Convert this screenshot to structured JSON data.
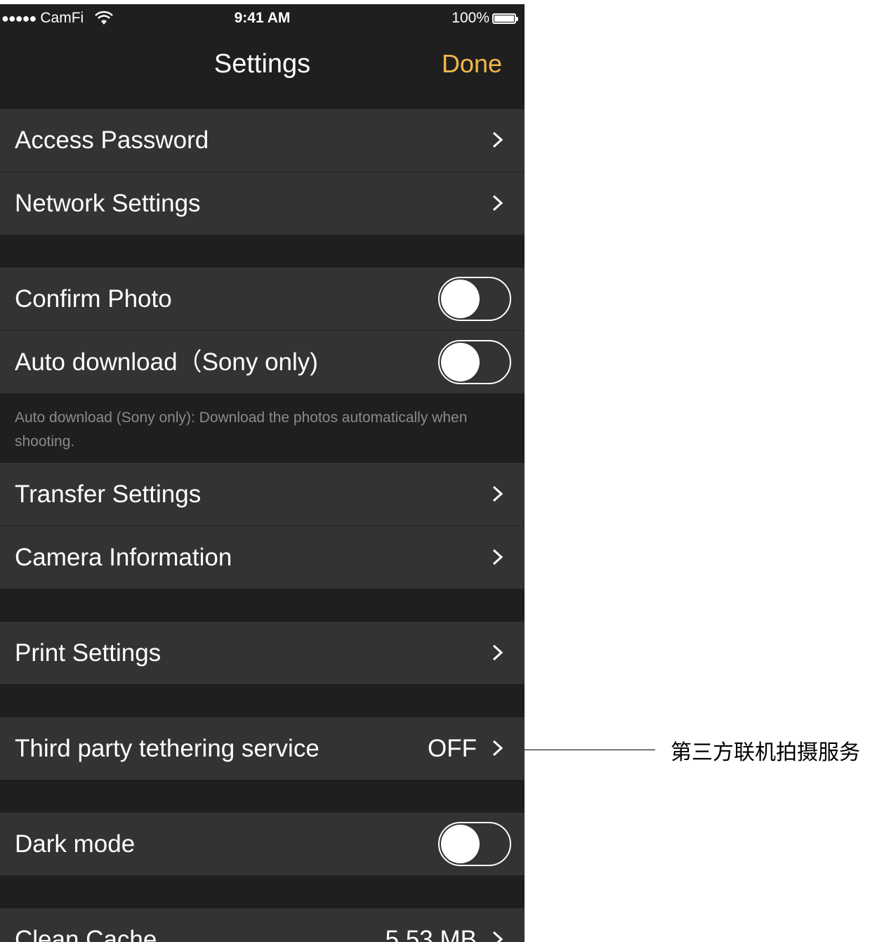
{
  "status_bar": {
    "signal": "●●●●●",
    "carrier": "CamFi",
    "time": "9:41 AM",
    "battery": "100%"
  },
  "nav": {
    "title": "Settings",
    "done": "Done"
  },
  "rows": {
    "access_password": "Access Password",
    "network_settings": "Network Settings",
    "confirm_photo": "Confirm Photo",
    "auto_download": "Auto download（Sony only)",
    "auto_download_note": "Auto download (Sony only): Download the photos automatically when shooting.",
    "transfer_settings": "Transfer Settings",
    "camera_information": "Camera Information",
    "print_settings": "Print Settings",
    "third_party": "Third party tethering service",
    "third_party_value": "OFF",
    "dark_mode": "Dark mode",
    "clean_cache": "Clean Cache",
    "clean_cache_value": "5.53 MB"
  },
  "toggles": {
    "confirm_photo": false,
    "auto_download": false,
    "dark_mode": false
  },
  "annotation": "第三方联机拍摄服务",
  "colors": {
    "accent": "#f3b64a",
    "row_bg": "#333333",
    "group_bg": "#1f1f1f"
  }
}
